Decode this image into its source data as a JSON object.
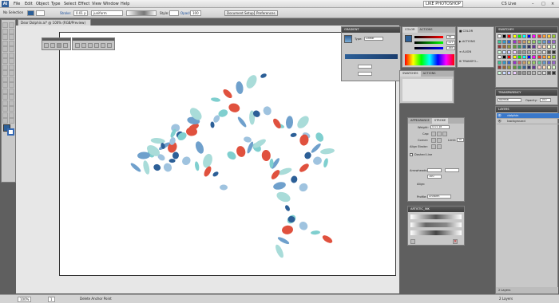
{
  "app": {
    "logo": "Ai"
  },
  "menubar": {
    "items": [
      "File",
      "Edit",
      "Object",
      "Type",
      "Select",
      "Effect",
      "View",
      "Window",
      "Help"
    ],
    "workspace": "LIKE PHOTOSHOP",
    "cs_live": "CS Live"
  },
  "control_bar": {
    "selection": "No Selection",
    "stroke_label": "Stroke:",
    "stroke_value": "0.01 p",
    "brush_value": "juniform",
    "style_label": "Style:",
    "opacity_label": "Opacity:",
    "opacity_value": "100",
    "document_setup": "Document Setup",
    "preferences": "Preferences"
  },
  "document": {
    "tab_title": "Dear Dolphin.ai* @ 100% (RGB/Preview)"
  },
  "panels": {
    "gradient": {
      "title": "GRADIENT",
      "type_label": "Type:",
      "type_value": "Linear"
    },
    "color": {
      "title": "COLOR",
      "tab2": "ACTIONS",
      "values": [
        "38",
        "117",
        "168"
      ]
    },
    "dock": {
      "items": [
        "COLOR",
        "ACTIONS",
        "ALIGN",
        "TRANSFO..."
      ]
    },
    "swatches": {
      "title": "SWATCHES"
    },
    "transparency": {
      "title": "TRANSPARENCY",
      "mode": "Normal",
      "opacity_label": "Opacity:",
      "opacity_value": "100"
    },
    "layers": {
      "title": "LAYERS",
      "rows": [
        "dolphin",
        "background"
      ],
      "footer": "2 Layers"
    },
    "swatches_small": {
      "title": "SWATCHES",
      "tab2": "ACTIONS"
    },
    "stroke": {
      "tab1": "APPEARANCE",
      "tab2": "STROKE",
      "weight_label": "Weight:",
      "weight_value": "0.01 pt",
      "cap_label": "Cap:",
      "corner_label": "Corner:",
      "limit_label": "Limit:",
      "limit_value": "10",
      "align_label": "Align Stroke:",
      "dashed_label": "Dashed Line",
      "arrowheads_label": "Arrowheads:",
      "scale_value": "100",
      "align_value": "Align:",
      "profile_label": "Profile:",
      "profile_value": "Uniform"
    },
    "brushes": {
      "title": "ARTISTIC_INK"
    }
  },
  "status_bar": {
    "zoom": "100%",
    "artboard": "1",
    "tool": "Delete Anchor Point",
    "layers": "2 Layers"
  },
  "colors": {
    "dolphin_dark_blue": "#2c5f97",
    "dolphin_light_blue": "#9fc3df",
    "dolphin_teal": "#7fcfcf",
    "dolphin_red": "#e0513e",
    "accent_blue": "#3569b4"
  },
  "icons": [
    "selection-tool-icon",
    "direct-selection-icon",
    "pen-tool-icon",
    "type-tool-icon",
    "zoom-tool-icon",
    "hand-tool-icon"
  ]
}
